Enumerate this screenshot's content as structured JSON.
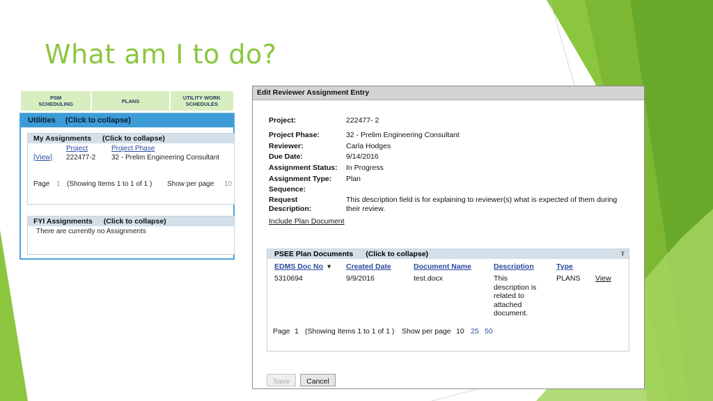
{
  "slide": {
    "title": "What am I to do?"
  },
  "colors": {
    "title_green": "#8cc63f",
    "header_blue": "#3d9bd6",
    "subheader": "#d3e0ea",
    "nav_green": "#d9eec0"
  },
  "left": {
    "nav": [
      "PSM SCHEDULING",
      "PLANS",
      "UTILITY WORK SCHEDULES"
    ],
    "utilities_header": {
      "title": "Utilities",
      "collapse": "(Click to collapse)"
    },
    "my_assignments": {
      "title": "My Assignments",
      "collapse": "(Click to collapse)",
      "col_project": "Project",
      "col_phase": "Project Phase",
      "row": {
        "view": "[View]",
        "project": "222477-2",
        "phase": "32 - Prelim Engineering Consultant"
      },
      "pager": {
        "page_label": "Page",
        "page_num": "1",
        "showing": "(Showing Items 1 to 1 of 1 )",
        "per_page": "Show per page",
        "per_page_val": "10"
      }
    },
    "fyi": {
      "title": "FYI Assignments",
      "collapse": "(Click to collapse)",
      "empty": "There are currently no Assignments"
    }
  },
  "dialog": {
    "title": "Edit Reviewer Assignment Entry",
    "fields": [
      {
        "label": "Project:",
        "value": "222477-  2"
      },
      {
        "label": "Project Phase:",
        "value": "32 - Prelim Engineering Consultant"
      },
      {
        "label": "Reviewer:",
        "value": "Carla Hodges"
      },
      {
        "label": "Due Date:",
        "value": "9/14/2016"
      },
      {
        "label": "Assignment Status:",
        "value": "In Progress"
      },
      {
        "label": "Assignment Type:",
        "value": "Plan"
      },
      {
        "label": "Sequence:",
        "value": ""
      }
    ],
    "request": {
      "label1": "Request",
      "label2": "Description:",
      "line1": "This description field is for explaining to reviewer(s) what is expected of them during",
      "line2": "their review."
    },
    "include_link": "Include Plan Document",
    "docs": {
      "title": "PSEE Plan Documents",
      "collapse": "(Click to collapse)",
      "pin": "Ŧ",
      "columns": [
        "EDMS Doc No",
        "Created Date",
        "Document Name",
        "Description",
        "Type"
      ],
      "sort_indicator": "▾",
      "row": {
        "doc_no": "5310694",
        "created": "9/9/2016",
        "name": "test.docx",
        "desc_lines": [
          "This",
          "description is",
          "related to",
          "attached",
          "document."
        ],
        "type": "PLANS",
        "view": "View"
      },
      "pager": {
        "page_label": "Page",
        "page_num": "1",
        "showing": "(Showing Items 1 to 1 of 1 )",
        "per_page": "Show per page",
        "opt1": "10",
        "opt2": "25",
        "opt3": "50"
      }
    },
    "buttons": {
      "save": "Save",
      "cancel": "Cancel"
    }
  }
}
